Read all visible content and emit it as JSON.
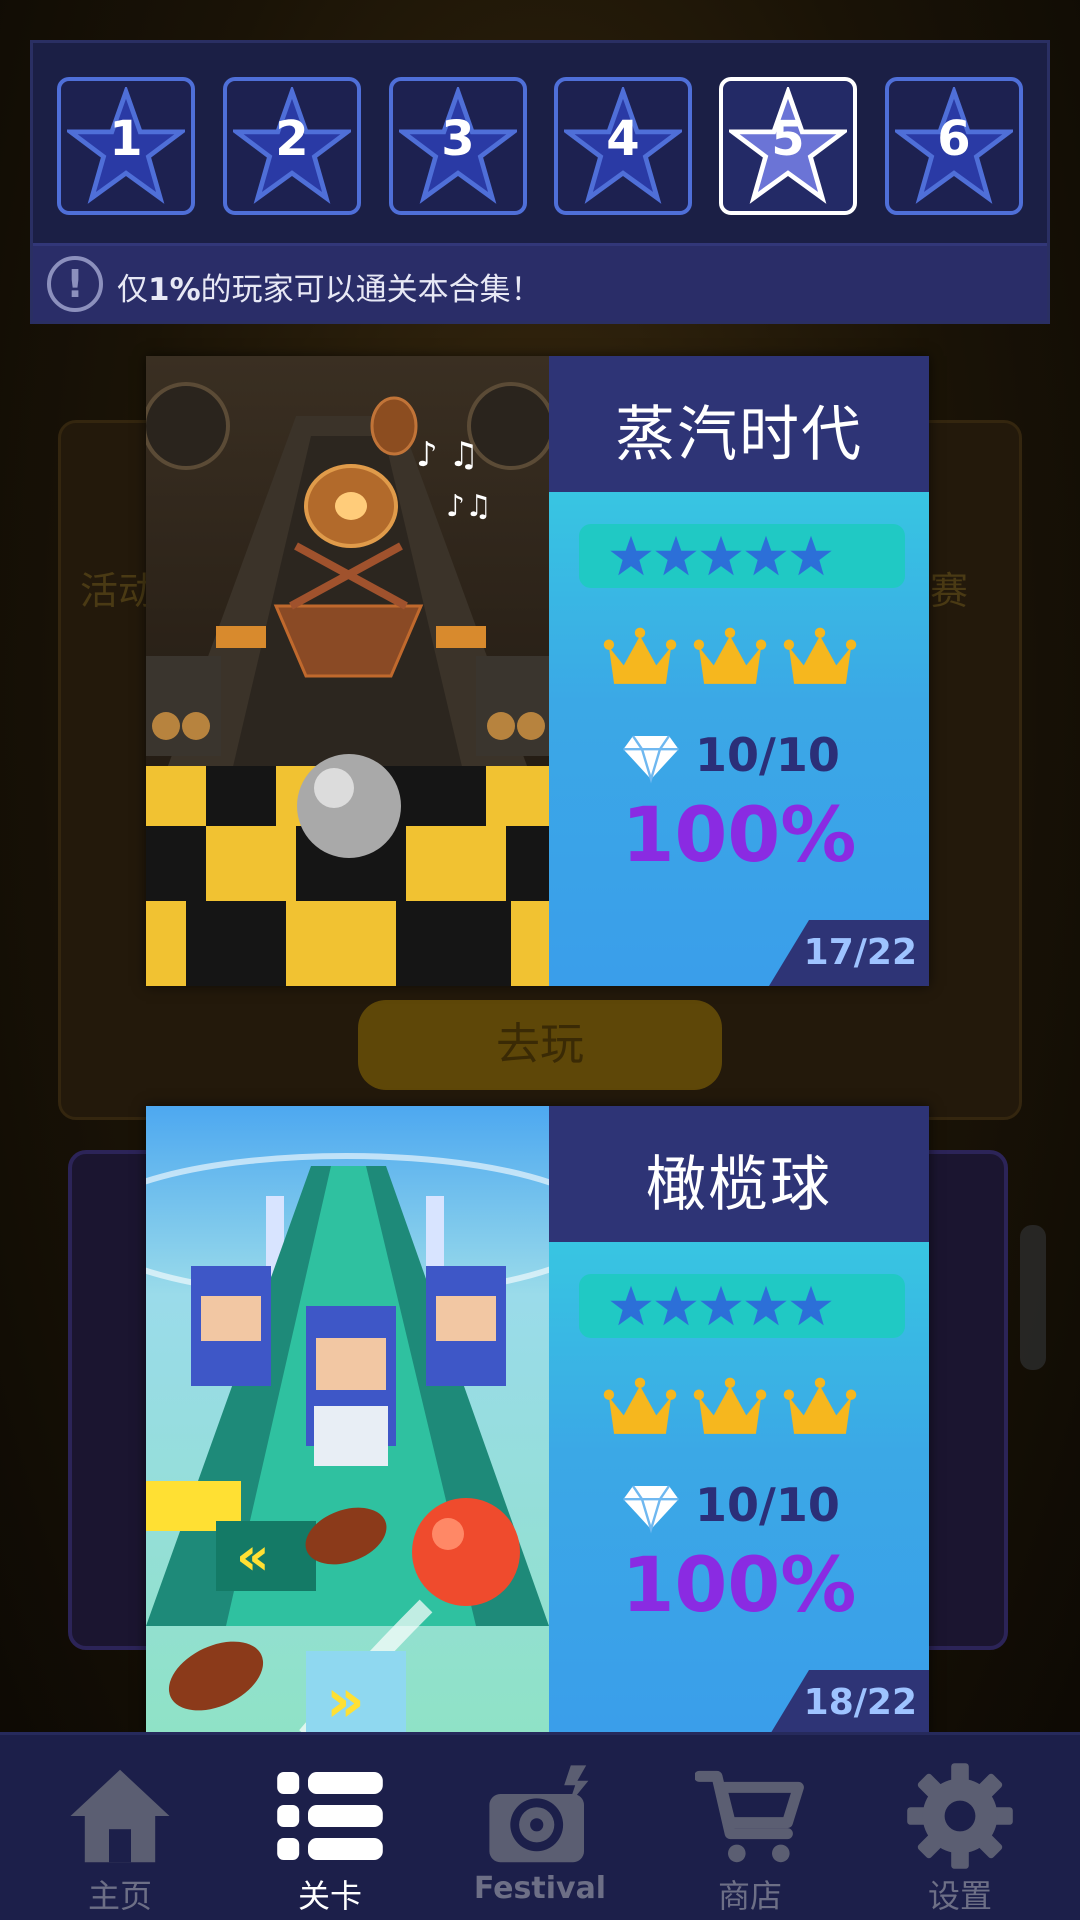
{
  "background": {
    "play_button_label": "去玩",
    "left_text": "活动",
    "right_text": "赛"
  },
  "chapter_tabs": {
    "items": [
      {
        "label": "1",
        "active": false
      },
      {
        "label": "2",
        "active": false
      },
      {
        "label": "3",
        "active": false
      },
      {
        "label": "4",
        "active": false
      },
      {
        "label": "5",
        "active": true
      },
      {
        "label": "6",
        "active": false
      }
    ],
    "notice_icon": "exclamation-icon",
    "notice_prefix": "仅",
    "notice_highlight": "1%",
    "notice_suffix": "的玩家可以通关本合集！"
  },
  "levels": [
    {
      "title": "蒸汽时代",
      "stars": 5,
      "crowns": 3,
      "gems": "10/10",
      "progress_percent": "100%",
      "index": "17/22",
      "art": "steampunk-level-art"
    },
    {
      "title": "橄榄球",
      "stars": 5,
      "crowns": 3,
      "gems": "10/10",
      "progress_percent": "100%",
      "index": "18/22",
      "art": "rugby-level-art"
    }
  ],
  "nav": {
    "items": [
      {
        "label": "主页",
        "icon": "home-icon",
        "active": false
      },
      {
        "label": "关卡",
        "icon": "list-icon",
        "active": true
      },
      {
        "label": "Festival",
        "icon": "festival-disc-icon",
        "active": false
      },
      {
        "label": "商店",
        "icon": "cart-icon",
        "active": false
      },
      {
        "label": "设置",
        "icon": "gear-icon",
        "active": false
      }
    ]
  },
  "colors": {
    "panel_bg": "#1b1f45",
    "tile_border": "#4f6fd8",
    "info_gradient_top": "#35d8df",
    "info_gradient_bottom": "#3a9eea",
    "percent": "#8a2be2",
    "crown": "#f6b71e",
    "star_blue": "#2c6fd8"
  }
}
